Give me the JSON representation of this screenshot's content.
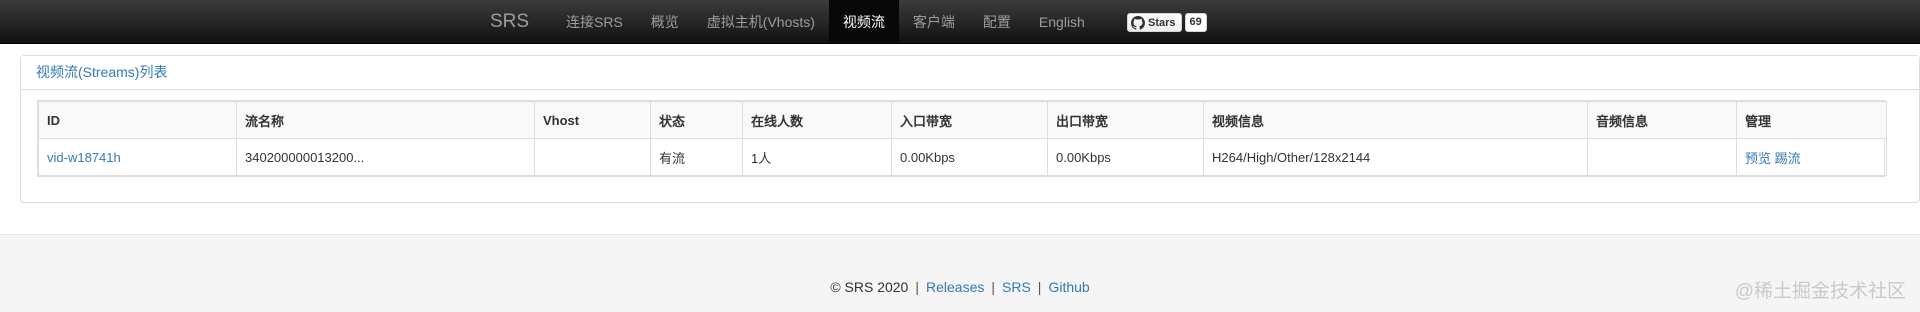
{
  "navbar": {
    "brand": "SRS",
    "items": [
      {
        "label": "连接SRS",
        "active": false
      },
      {
        "label": "概览",
        "active": false
      },
      {
        "label": "虚拟主机(Vhosts)",
        "active": false
      },
      {
        "label": "视频流",
        "active": true
      },
      {
        "label": "客户端",
        "active": false
      },
      {
        "label": "配置",
        "active": false
      },
      {
        "label": "English",
        "active": false
      }
    ],
    "github": {
      "icon": "github-icon",
      "stars_label": "Stars",
      "stars_count": "69"
    }
  },
  "panel": {
    "title": "视频流(Streams)列表",
    "table": {
      "columns": [
        "ID",
        "流名称",
        "Vhost",
        "状态",
        "在线人数",
        "入口带宽",
        "出口带宽",
        "视频信息",
        "音频信息",
        "管理"
      ],
      "rows": [
        {
          "id": "vid-w18741h",
          "name": "340200000013200...",
          "vhost": "",
          "status": "有流",
          "clients": "1人",
          "in_bw": "0.00Kbps",
          "out_bw": "0.00Kbps",
          "video": "H264/High/Other/128x2144",
          "audio": "",
          "actions": {
            "preview": "预览",
            "kick": "踢流"
          }
        }
      ]
    }
  },
  "footer": {
    "copyright": "© SRS 2020",
    "links": [
      "Releases",
      "SRS",
      "Github"
    ],
    "separator": "|"
  },
  "watermark": "@稀土掘金技术社区",
  "colors": {
    "link": "#337ab7",
    "navbar_bg": "#222222",
    "nav_text": "#9d9d9d"
  }
}
